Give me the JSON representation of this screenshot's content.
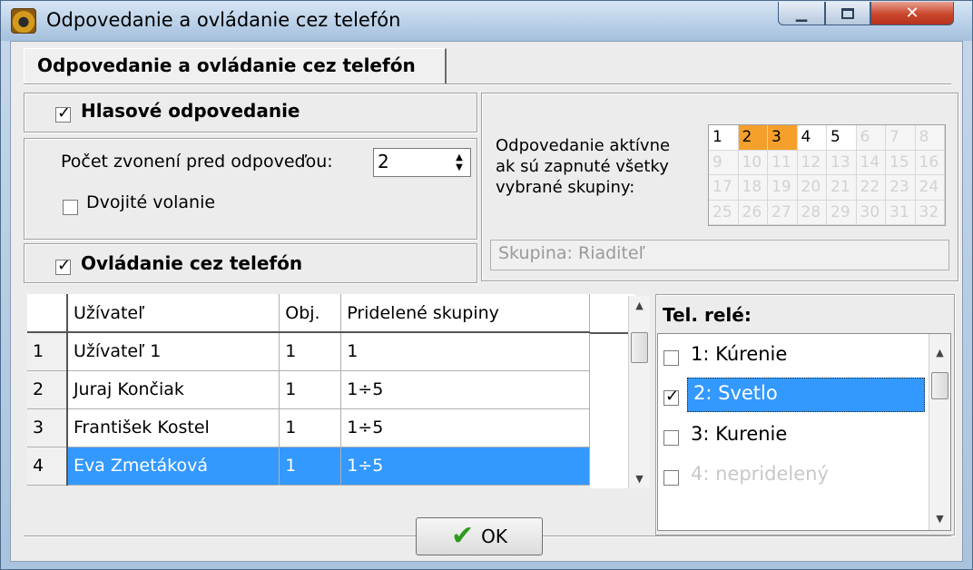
{
  "window": {
    "title": "Odpovedanie a ovládanie cez telefón",
    "minimize_icon": "minimize-icon",
    "maximize_icon": "maximize-icon",
    "close_icon": "close-icon"
  },
  "tab": {
    "label": "Odpovedanie a ovládanie cez telefón"
  },
  "voice_answering": {
    "label": "Hlasové odpovedanie",
    "checked": true
  },
  "rings": {
    "label": "Počet zvonení pred odpoveďou:",
    "value": "2"
  },
  "double_call": {
    "label": "Dvojité volanie",
    "checked": false
  },
  "phone_control": {
    "label": "Ovládanie cez telefón",
    "checked": true
  },
  "answer_active": {
    "line1": "Odpovedanie aktívne",
    "line2": "ak sú zapnuté všetky",
    "line3": "vybrané skupiny:",
    "groups": [
      "1",
      "2",
      "3",
      "4",
      "5",
      "6",
      "7",
      "8",
      "9",
      "10",
      "11",
      "12",
      "13",
      "14",
      "15",
      "16",
      "17",
      "18",
      "19",
      "20",
      "21",
      "22",
      "23",
      "24",
      "25",
      "26",
      "27",
      "28",
      "29",
      "30",
      "31",
      "32"
    ],
    "enabled_count": 5,
    "selected": [
      "2",
      "3"
    ],
    "highlight_color": "#f4a02a"
  },
  "group_field": {
    "text": "Skupina: Riaditeľ"
  },
  "users_table": {
    "headers": [
      "",
      "Užívateľ",
      "Obj.",
      "Pridelené skupiny"
    ],
    "rows": [
      [
        "1",
        "Užívateľ  1",
        "1",
        "1"
      ],
      [
        "2",
        "Juraj Končiak",
        "1",
        "1÷5"
      ],
      [
        "3",
        "František Kostel",
        "1",
        "1÷5"
      ],
      [
        "4",
        "Eva Zmetáková",
        "1",
        "1÷5"
      ]
    ],
    "selected_row": 3,
    "selection_color": "#3399ff"
  },
  "relays": {
    "label": "Tel. relé:",
    "items": [
      {
        "text": "1: Kúrenie",
        "checked": false
      },
      {
        "text": "2: Svetlo",
        "checked": true
      },
      {
        "text": "3: Kurenie",
        "checked": false
      },
      {
        "text": "4: nepridelený",
        "checked": false
      }
    ]
  },
  "ok_button": {
    "label": "OK",
    "icon": "checkmark-icon"
  }
}
